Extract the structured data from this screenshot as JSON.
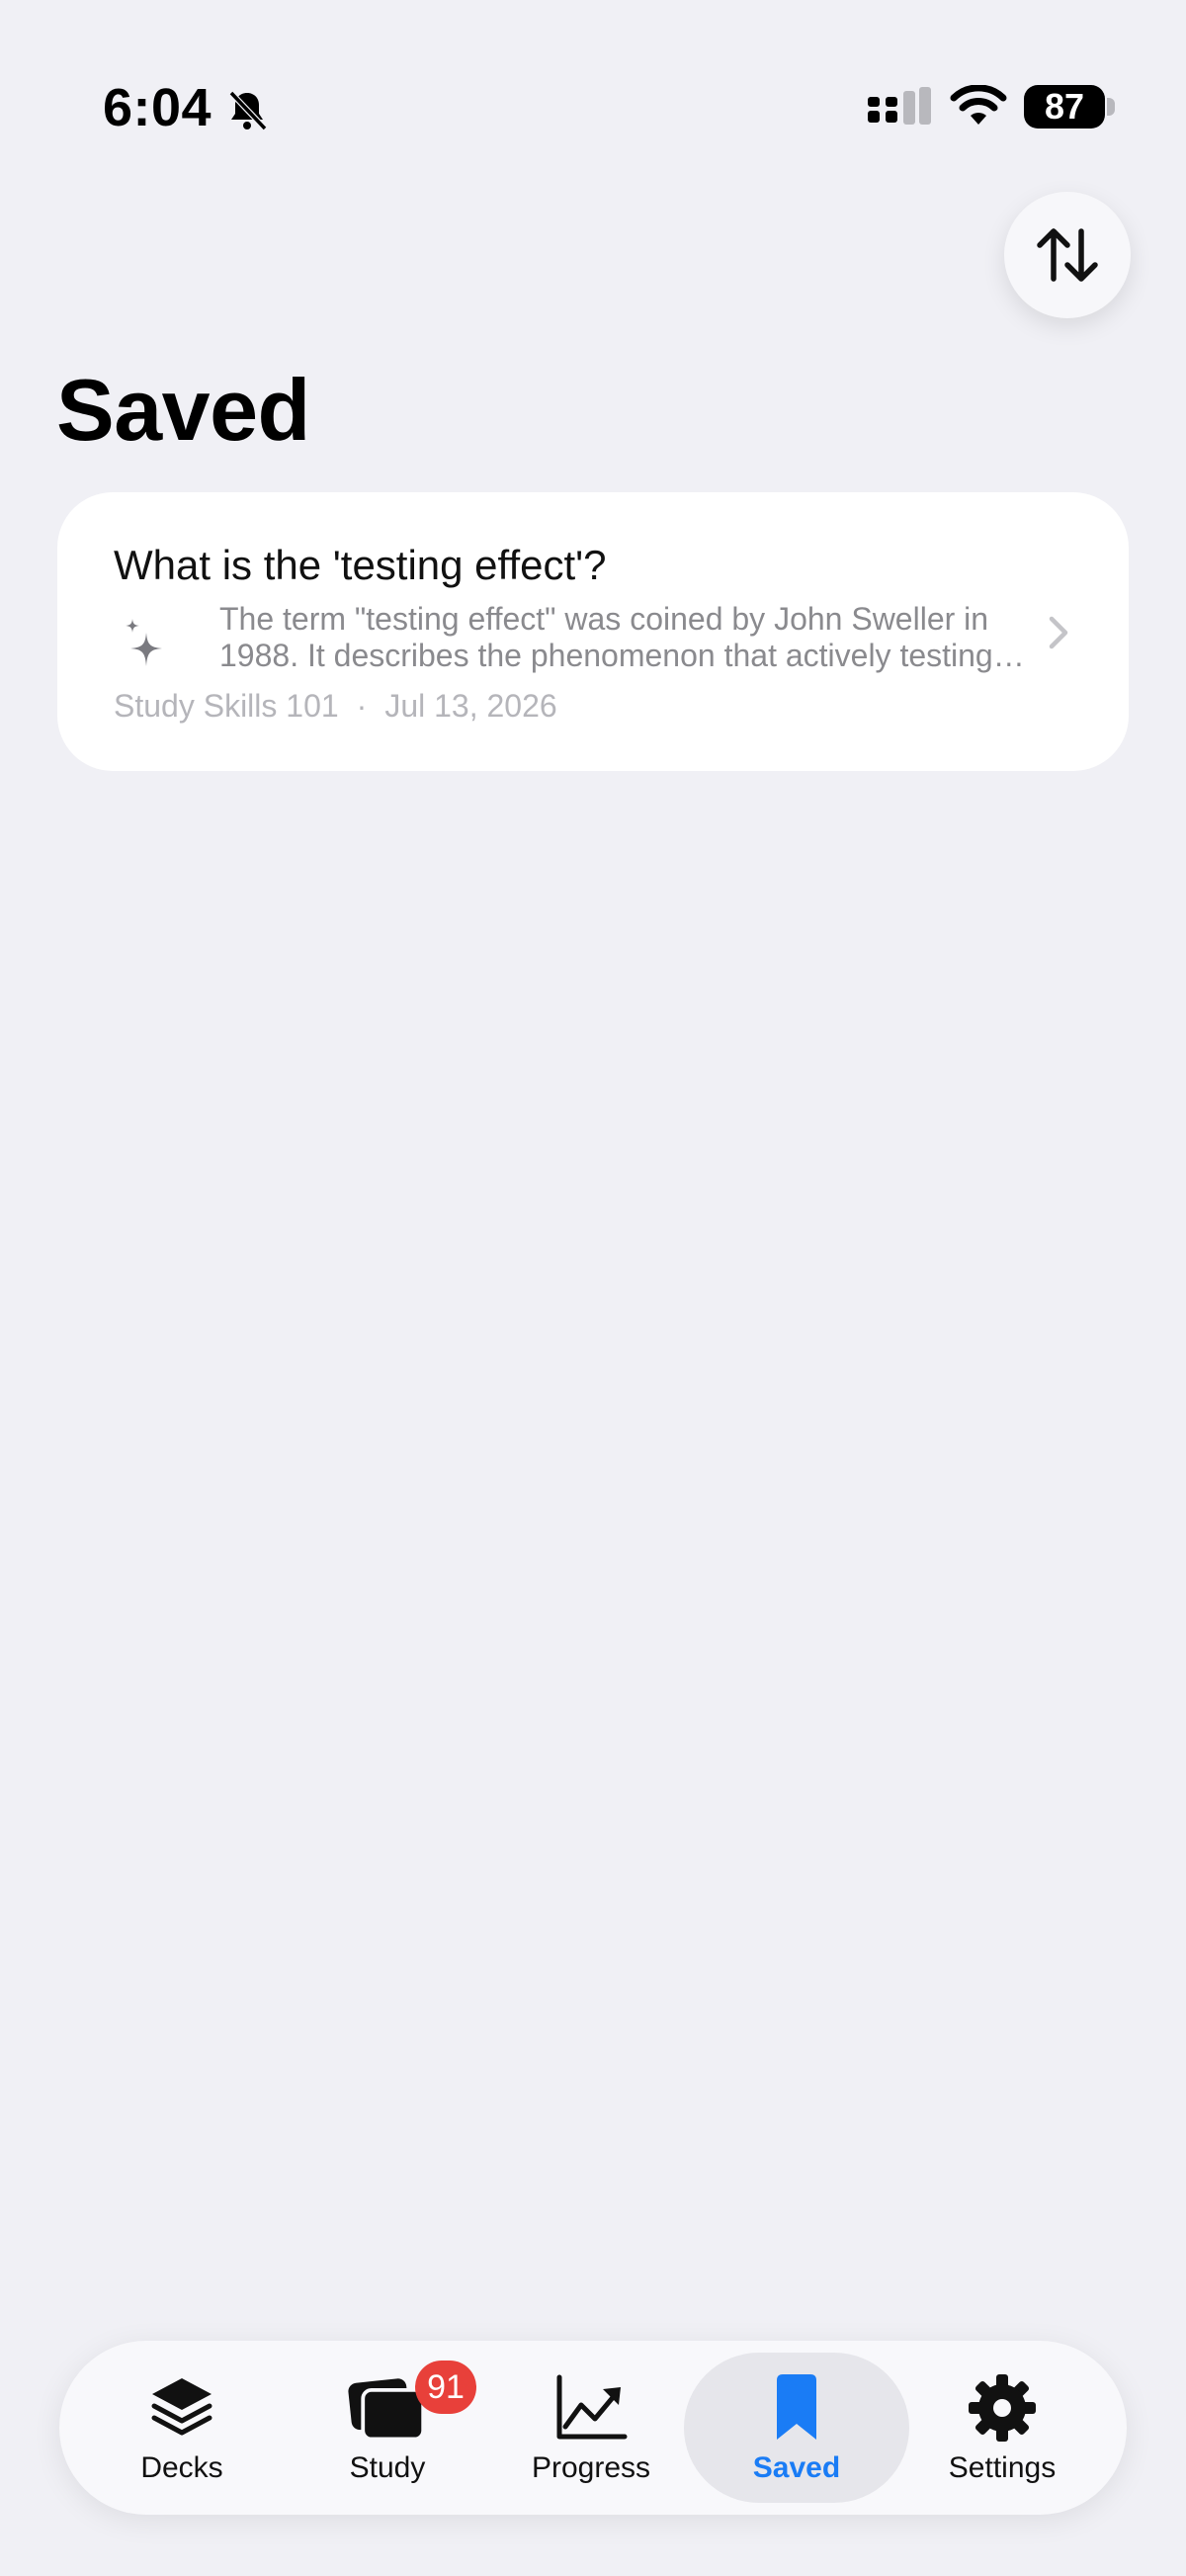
{
  "status_bar": {
    "time": "6:04",
    "battery": "87",
    "icons": [
      "bell-slash-icon",
      "cellular-signal-icon",
      "wifi-icon",
      "battery-icon"
    ]
  },
  "header": {
    "title": "Saved",
    "sort_icon": "arrow-up-down-icon"
  },
  "saved_items": [
    {
      "question": "What is the 'testing effect'?",
      "answer": "The term \"testing effect\" was coined by John Sweller in 1988. It describes the phenomenon that actively testing yourself improves long-term retention.",
      "deck": "Study Skills 101",
      "separator": "·",
      "date": "Jul 13, 2026",
      "icon": "sparkle-icon"
    }
  ],
  "tab_bar": {
    "tabs": [
      {
        "label": "Decks",
        "icon": "stack-icon"
      },
      {
        "label": "Study",
        "icon": "cards-icon",
        "badge": "91"
      },
      {
        "label": "Progress",
        "icon": "chart-line-icon"
      },
      {
        "label": "Saved",
        "icon": "bookmark-icon",
        "active": true
      },
      {
        "label": "Settings",
        "icon": "gear-icon"
      }
    ]
  },
  "colors": {
    "background": "#f0f0f5",
    "accent": "#1a7cf5",
    "badge": "#e8403a"
  }
}
